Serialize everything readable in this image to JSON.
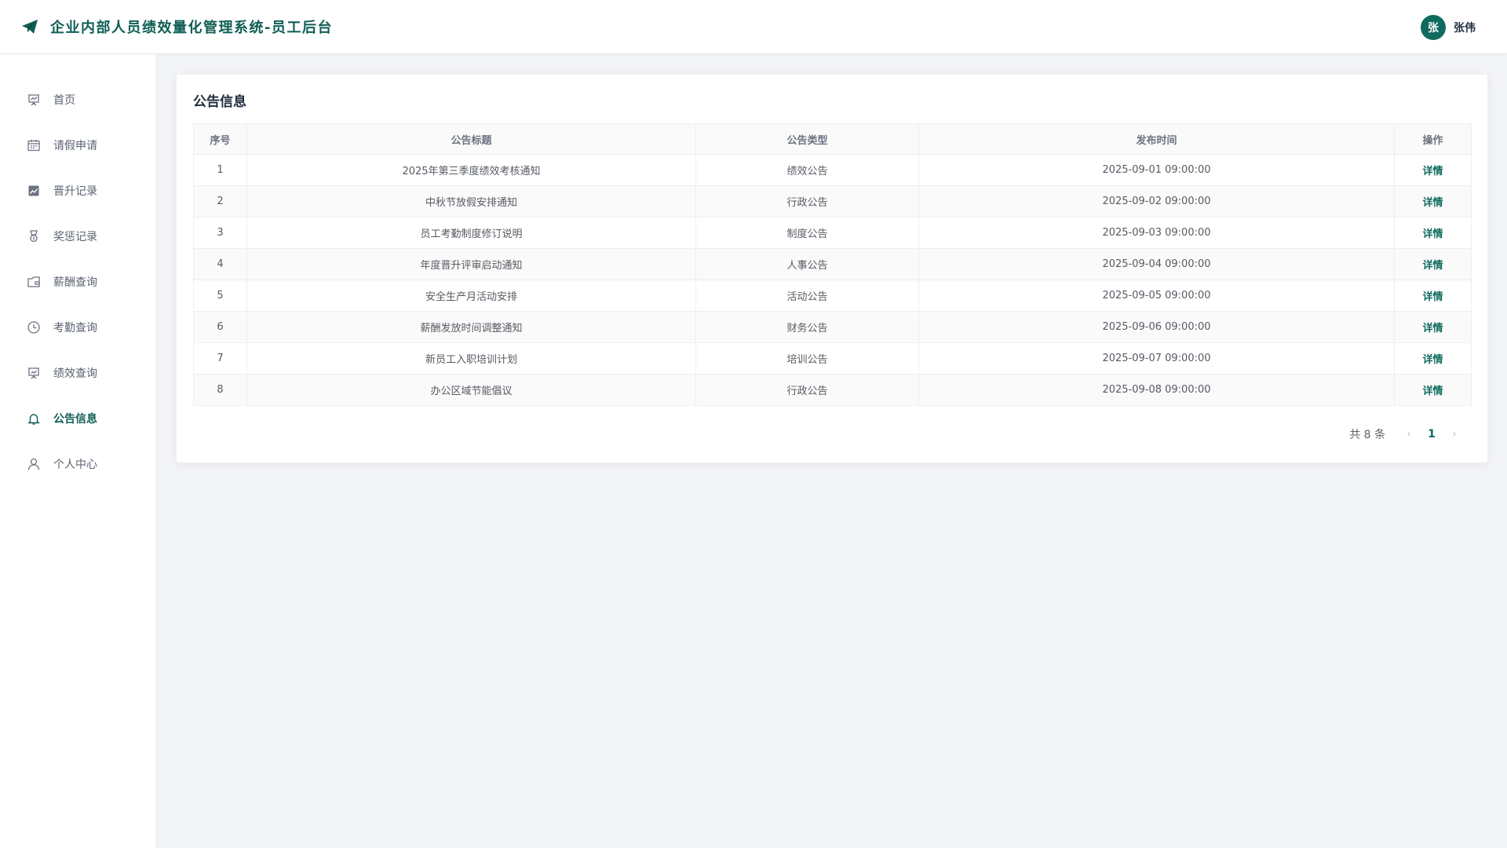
{
  "header": {
    "title": "企业内部人员绩效量化管理系统-员工后台",
    "avatar_char": "张",
    "username": "张伟"
  },
  "sidebar": {
    "items": [
      {
        "label": "首页",
        "icon": "presentation-icon"
      },
      {
        "label": "请假申请",
        "icon": "calendar-icon"
      },
      {
        "label": "晋升记录",
        "icon": "trend-chart-icon"
      },
      {
        "label": "奖惩记录",
        "icon": "medal-icon"
      },
      {
        "label": "薪酬查询",
        "icon": "wallet-icon"
      },
      {
        "label": "考勤查询",
        "icon": "clock-icon"
      },
      {
        "label": "绩效查询",
        "icon": "board-icon"
      },
      {
        "label": "公告信息",
        "icon": "bell-icon",
        "active": true
      },
      {
        "label": "个人中心",
        "icon": "user-icon"
      }
    ]
  },
  "main": {
    "card_title": "公告信息",
    "columns": [
      "序号",
      "公告标题",
      "公告类型",
      "发布时间",
      "操作"
    ],
    "rows": [
      {
        "no": "1",
        "title": "2025年第三季度绩效考核通知",
        "type": "绩效公告",
        "time": "2025-09-01 09:00:00",
        "action": "详情"
      },
      {
        "no": "2",
        "title": "中秋节放假安排通知",
        "type": "行政公告",
        "time": "2025-09-02 09:00:00",
        "action": "详情"
      },
      {
        "no": "3",
        "title": "员工考勤制度修订说明",
        "type": "制度公告",
        "time": "2025-09-03 09:00:00",
        "action": "详情"
      },
      {
        "no": "4",
        "title": "年度晋升评审启动通知",
        "type": "人事公告",
        "time": "2025-09-04 09:00:00",
        "action": "详情"
      },
      {
        "no": "5",
        "title": "安全生产月活动安排",
        "type": "活动公告",
        "time": "2025-09-05 09:00:00",
        "action": "详情"
      },
      {
        "no": "6",
        "title": "薪酬发放时间调整通知",
        "type": "财务公告",
        "time": "2025-09-06 09:00:00",
        "action": "详情"
      },
      {
        "no": "7",
        "title": "新员工入职培训计划",
        "type": "培训公告",
        "time": "2025-09-07 09:00:00",
        "action": "详情"
      },
      {
        "no": "8",
        "title": "办公区域节能倡议",
        "type": "行政公告",
        "time": "2025-09-08 09:00:00",
        "action": "详情"
      }
    ],
    "pagination": {
      "total_label": "共 8 条",
      "prev": "‹",
      "current_page": "1",
      "next": "›"
    }
  },
  "colors": {
    "accent": "#0f5e55",
    "avatar_bg": "#0f6b60",
    "page_bg": "#f3f4f6"
  }
}
